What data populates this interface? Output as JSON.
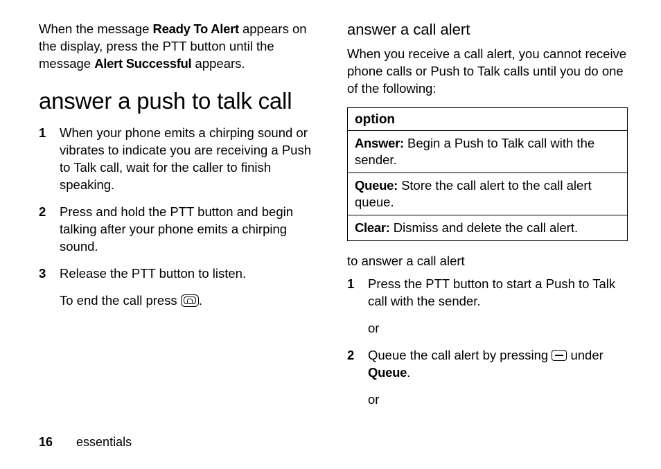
{
  "left": {
    "intro_pre": "When the message ",
    "intro_bold1": "Ready To Alert",
    "intro_mid": " appears on the display, press the PTT button until the message ",
    "intro_bold2": "Alert Successful",
    "intro_post": " appears.",
    "heading": "answer a push to talk call",
    "steps": [
      "When your phone emits a chirping sound or vibrates to indicate you are receiving a Push to Talk call, wait for the caller to finish speaking.",
      "Press and hold the PTT button and begin talking after your phone emits a chirping sound.",
      "Release the PTT button to listen."
    ],
    "end_note_pre": "To end the call press ",
    "end_note_post": "."
  },
  "right": {
    "heading": "answer a call alert",
    "body": "When you receive a call alert, you cannot receive phone calls or Push to Talk calls until you do one of the following:",
    "table": {
      "header": "option",
      "rows": [
        {
          "label": "Answer:",
          "text": " Begin a Push to Talk call with the sender."
        },
        {
          "label": "Queue:",
          "text": " Store the call alert to the call alert queue."
        },
        {
          "label": "Clear:",
          "text": " Dismiss and delete the call alert."
        }
      ]
    },
    "sub_heading": "to answer a call alert",
    "step1": "Press the PTT button to start a Push to Talk call with the sender.",
    "or": "or",
    "step2_pre": "Queue the call alert by pressing ",
    "step2_mid": " under ",
    "step2_bold": "Queue",
    "step2_post": "."
  },
  "footer": {
    "page": "16",
    "section": "essentials"
  }
}
